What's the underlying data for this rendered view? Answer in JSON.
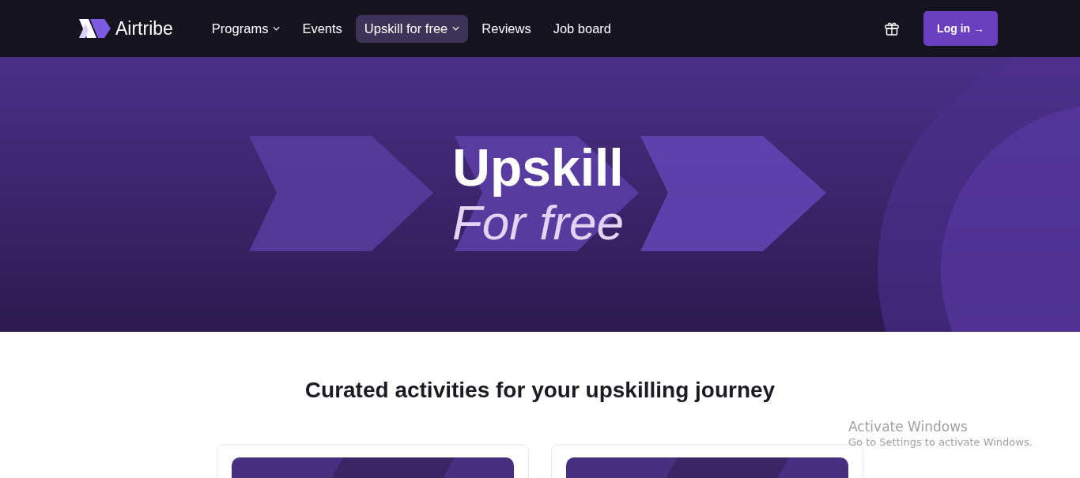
{
  "brand": {
    "name": "Airtribe"
  },
  "nav": [
    {
      "label": "Programs",
      "dropdown": true,
      "selected": false
    },
    {
      "label": "Events",
      "dropdown": false,
      "selected": false
    },
    {
      "label": "Upskill for free",
      "dropdown": true,
      "selected": true
    },
    {
      "label": "Reviews",
      "dropdown": false,
      "selected": false
    },
    {
      "label": "Job board",
      "dropdown": false,
      "selected": false
    }
  ],
  "login_button": {
    "label": "Log in →"
  },
  "hero": {
    "title": "Upskill",
    "subtitle": "For free"
  },
  "section": {
    "heading": "Curated activities for your upskilling journey",
    "cards": [
      {
        "kind": "banner"
      },
      {
        "kind": "banner"
      }
    ]
  },
  "os_overlay": {
    "title": "Activate Windows",
    "subtitle": "Go to Settings to activate Windows."
  }
}
